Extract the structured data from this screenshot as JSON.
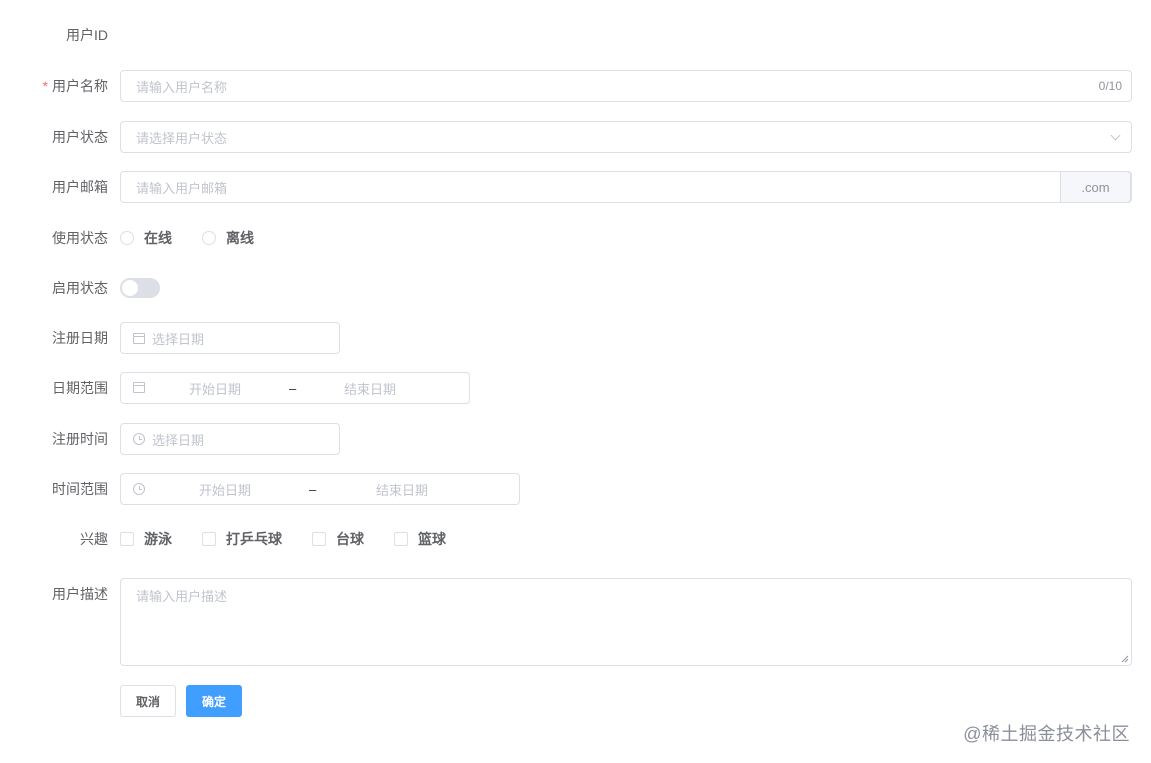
{
  "form": {
    "user_id": {
      "label": "用户ID"
    },
    "user_name": {
      "label": "用户名称",
      "required_mark": "*",
      "placeholder": "请输入用户名称",
      "counter": "0/10"
    },
    "user_status": {
      "label": "用户状态",
      "placeholder": "请选择用户状态"
    },
    "user_email": {
      "label": "用户邮箱",
      "placeholder": "请输入用户邮箱",
      "suffix": ".com"
    },
    "usage_status": {
      "label": "使用状态",
      "options": [
        "在线",
        "离线"
      ]
    },
    "enabled_status": {
      "label": "启用状态",
      "enabled": false
    },
    "register_date": {
      "label": "注册日期",
      "placeholder": "选择日期"
    },
    "date_range": {
      "label": "日期范围",
      "start_placeholder": "开始日期",
      "separator": "–",
      "end_placeholder": "结束日期"
    },
    "register_time": {
      "label": "注册时间",
      "placeholder": "选择日期"
    },
    "time_range": {
      "label": "时间范围",
      "start_placeholder": "开始日期",
      "separator": "–",
      "end_placeholder": "结束日期"
    },
    "interests": {
      "label": "兴趣",
      "options": [
        "游泳",
        "打乒乓球",
        "台球",
        "篮球"
      ]
    },
    "description": {
      "label": "用户描述",
      "placeholder": "请输入用户描述"
    },
    "buttons": {
      "cancel": "取消",
      "confirm": "确定"
    }
  },
  "watermark": "@稀土掘金技术社区",
  "colors": {
    "primary": "#409eff",
    "border": "#dcdfe6",
    "placeholder": "#c0c4cc",
    "required": "#f56c6c"
  }
}
